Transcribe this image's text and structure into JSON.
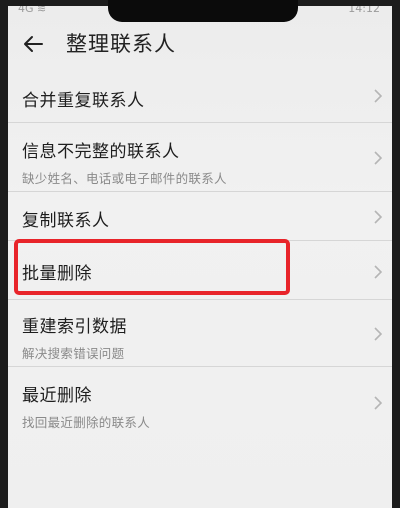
{
  "status_bar": {
    "left": "4G ≋",
    "right": "14:12"
  },
  "header": {
    "title": "整理联系人"
  },
  "menu": {
    "items": [
      {
        "label": "合并重复联系人",
        "sub": ""
      },
      {
        "label": "信息不完整的联系人",
        "sub": "缺少姓名、电话或电子邮件的联系人"
      },
      {
        "label": "复制联系人",
        "sub": ""
      },
      {
        "label": "批量删除",
        "sub": ""
      },
      {
        "label": "重建索引数据",
        "sub": "解决搜索错误问题"
      },
      {
        "label": "最近删除",
        "sub": "找回最近删除的联系人"
      }
    ]
  },
  "icons": {
    "back": "arrow-left-icon",
    "chevron": "chevron-right-icon"
  },
  "colors": {
    "highlight": "#e8242a",
    "text": "#1e1e1e",
    "subtext": "#8a8a8a",
    "background": "#efefef"
  }
}
